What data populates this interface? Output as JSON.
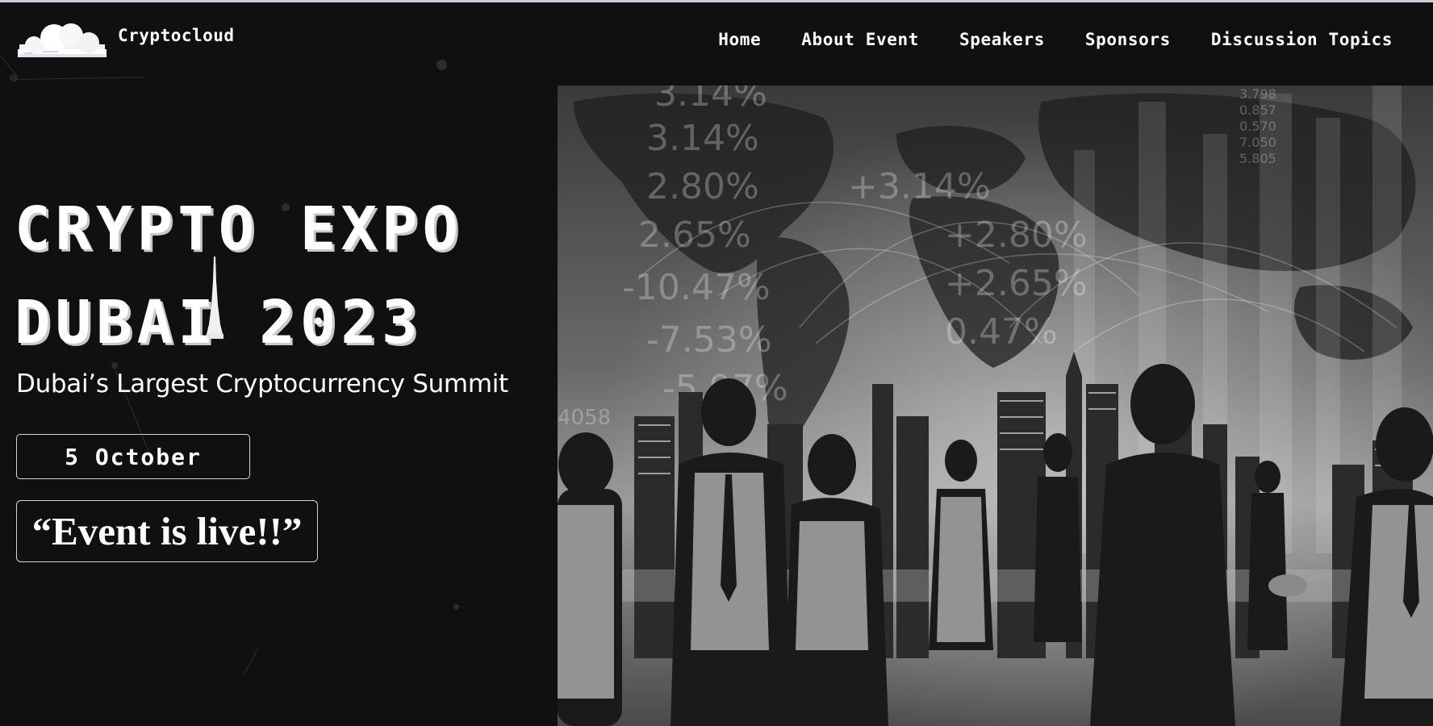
{
  "brand": {
    "name": "Cryptocloud",
    "logo_icon": "cloud-logo-icon"
  },
  "nav": {
    "links": [
      {
        "label": "Home"
      },
      {
        "label": "About Event"
      },
      {
        "label": "Speakers"
      },
      {
        "label": "Sponsors"
      },
      {
        "label": "Discussion Topics"
      }
    ]
  },
  "hero": {
    "title_line1": "CRYPTO EXPO",
    "title_line2": "DUBAI 2023",
    "subtitle": "Dubai’s Largest Cryptocurrency Summit",
    "date": "5 October",
    "status": "“Event is live!!”",
    "image": {
      "description_icon": "business-people-city-skyline-image",
      "overlay_numbers": [
        "3.14%",
        "2.80%",
        "2.65%",
        "-10.47%",
        "-7.53%",
        "-5.97%",
        "4058",
        "+3.14%",
        "+2.80%",
        "+2.65%",
        "0.47%",
        "3.798",
        "0.857",
        "0.570",
        "7.050",
        "5.805"
      ]
    }
  },
  "colors": {
    "background": "#101011",
    "text": "#ffffff",
    "border": "#d5d5d5",
    "top_strip": "#c9cfe0"
  }
}
